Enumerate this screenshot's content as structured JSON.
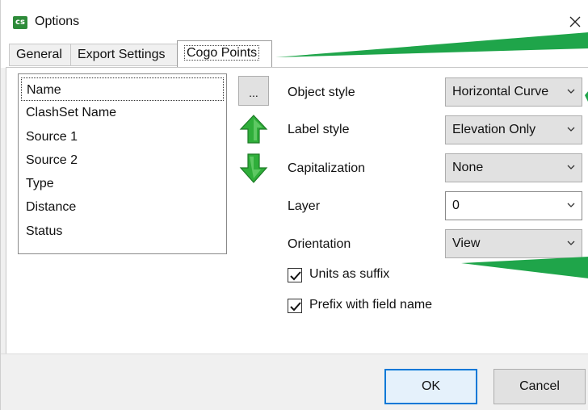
{
  "window": {
    "title": "Options",
    "app_icon_text": "cs",
    "close_glyph": "✕"
  },
  "tabs": [
    {
      "label": "General",
      "active": false
    },
    {
      "label": "Export Settings",
      "active": false
    },
    {
      "label": "Cogo Points",
      "active": true
    }
  ],
  "field_list": {
    "items": [
      "Name",
      "ClashSet Name",
      "Source 1",
      "Source 2",
      "Type",
      "Distance",
      "Status"
    ],
    "selected_index": 0
  },
  "side_buttons": {
    "ellipsis_label": "...",
    "move_up_icon": "arrow-up-icon",
    "move_down_icon": "arrow-down-icon"
  },
  "form": {
    "object_style": {
      "label": "Object style",
      "value": "Horizontal Curve"
    },
    "label_style": {
      "label": "Label style",
      "value": "Elevation Only"
    },
    "capitalization": {
      "label": "Capitalization",
      "value": "None"
    },
    "layer": {
      "label": "Layer",
      "value": "0"
    },
    "orientation": {
      "label": "Orientation",
      "value": "View"
    }
  },
  "checkboxes": {
    "units_as_suffix": {
      "label": "Units as suffix",
      "checked": true
    },
    "prefix_with_field_name": {
      "label": "Prefix with field name",
      "checked": true
    }
  },
  "footer": {
    "ok_label": "OK",
    "cancel_label": "Cancel"
  },
  "colors": {
    "arrow_green": "#2fae3a",
    "callout_green": "#1fa54a",
    "accent_blue": "#0078d7"
  }
}
